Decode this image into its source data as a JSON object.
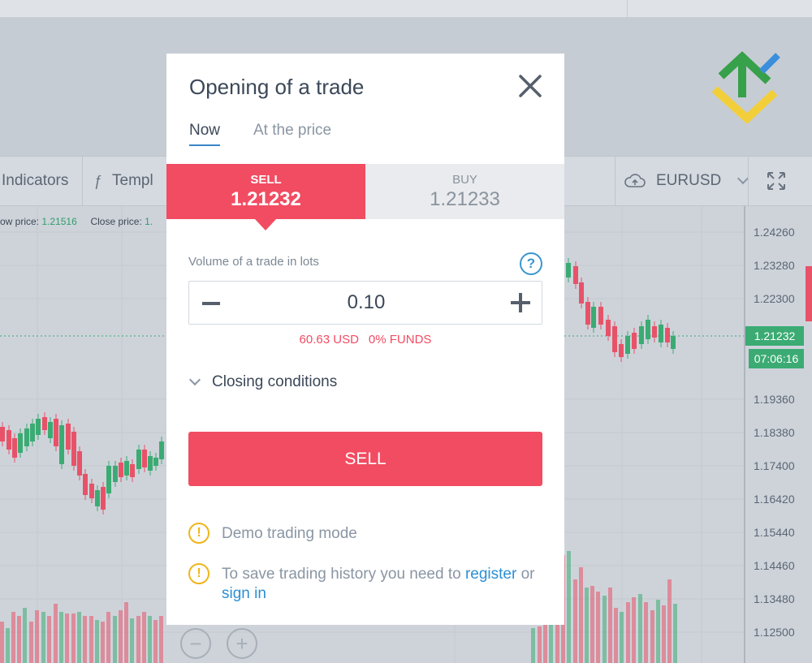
{
  "toolbar": {
    "indicators_label": "Indicators",
    "templates_icon": "function-icon",
    "templates_label": "Templ",
    "symbol_icon": "cloud-upload-icon",
    "symbol": "EURUSD",
    "fullscreen_icon": "expand-icon"
  },
  "chart": {
    "low_label": "ow price:",
    "low_value": "1.21516",
    "close_label": "Close price:",
    "close_value": "1.",
    "axis": [
      "1.24260",
      "1.23280",
      "1.22300",
      "1.19360",
      "1.18380",
      "1.17400",
      "1.16420",
      "1.15440",
      "1.14460",
      "1.13480",
      "1.12500"
    ],
    "current_price": "1.21232",
    "current_time": "07:06:16",
    "zoom_out": "−",
    "zoom_in": "+",
    "colors": {
      "up": "#3bab73",
      "down": "#e85268"
    }
  },
  "modal": {
    "title": "Opening of a trade",
    "close_icon": "close-icon",
    "tabs": {
      "now": "Now",
      "at_price": "At the price"
    },
    "sell": {
      "label": "SELL",
      "price": "1.21232"
    },
    "buy": {
      "label": "BUY",
      "price": "1.21233"
    },
    "volume_label": "Volume of a trade in lots",
    "help_icon": "?",
    "volume": "0.10",
    "margin": "60.63 USD",
    "funds": "0% FUNDS",
    "closing_conditions": "Closing conditions",
    "sell_button": "SELL",
    "warn_icon": "!",
    "notice_demo": "Demo trading mode",
    "notice_history_pre": "To save trading history you need to",
    "notice_register": "register",
    "notice_or": "or",
    "notice_sign_in": "sign in",
    "accent": "#f24c62"
  }
}
